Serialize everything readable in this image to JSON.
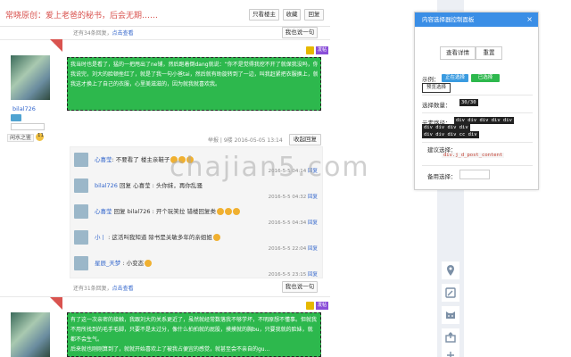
{
  "thread": {
    "title": "常晓原创：爱上老爸的秘书，后会无期……",
    "buttons": {
      "only_op": "只看楼主",
      "favorite": "收藏",
      "reply": "回复"
    }
  },
  "post_meta_top": {
    "count_text": "还有34条回复，",
    "link": "点击查看",
    "reply_btn": "我也说一句"
  },
  "post1": {
    "author": "bilal726",
    "fans_label": "闲水之鉴",
    "fans_count": "11",
    "hot_label": "热帖",
    "tag_purple": "发帖",
    "lines": [
      "我当时也是看了，猛的一把甩出了ne铺，然后跑着倒dang就说：“你不是觉得我挖不开了就保我没吗，你喜，我走着好了。”",
      "我说完，刘大的脸顿挫红了，就是了我一句小爸tai，然后就有助旋转到了一边，叫我赶紧把衣服换上，就说我要再这样，就不喜欢我了。",
      "我这才换上了自己的衣服，心里美滋滋的，因为就我就喜欢我。"
    ],
    "footer": {
      "report": "举报",
      "floor": "9楼",
      "datetime": "2016-05-05 13:14",
      "collapse": "收起回复"
    }
  },
  "replies": [
    {
      "name": "心喜莹",
      "text": ": 不要看了 楼主亲鞋子",
      "emoji_count": 3,
      "time": "2016-5-5 04:14",
      "reply": "回复"
    },
    {
      "name": "bilal726",
      "text": " 回复 心喜莹 : 头你妹，再你乱骚",
      "emoji_count": 0,
      "time": "2016-5-5 04:32",
      "reply": "回复"
    },
    {
      "name": "心喜莹",
      "text": " 回复 bilal726 : 开个玩笑拉 错楼回复类",
      "emoji_count": 3,
      "time": "2016-5-5 04:34",
      "reply": "回复"
    },
    {
      "name": "小丨",
      "text": " : 这活叫我知道 除书是关敏多年的亲姐姐",
      "emoji_count": 1,
      "time": "2016-5-5 22:04",
      "reply": "回复"
    },
    {
      "name": "星辰_天梦",
      "text": " : 小变态",
      "emoji_count": 1,
      "time": "2016-5-5 23:15",
      "reply": "回复"
    }
  ],
  "post_meta_mid": {
    "count_text": "还有31条回复，",
    "link": "点击查看",
    "reply_btn": "我也说一句"
  },
  "post2": {
    "hot_label": "热帖",
    "tag_purple": "发帖",
    "lines": [
      "有了这一次亲密的接触，我跟刘大的关系更近了，虽然就经常数落我不够学坏，不明原想不懂事。但就我不用所找到的毛手毛脚，只要不是太过分，像什么拍拍就的屁股，摸摸就的胸bu，只要我就的脸妹，就都不会生气。",
      "后来就也刚刚算到了，就就开始喜欢上了被我占便宜的感觉，就甚至会不亲自的gu..."
    ]
  },
  "panel": {
    "title": "内容选择器控制面板",
    "close_glyph": "×",
    "btn_detail": "查看详情",
    "btn_reset": "重置",
    "mode_label": "示例：",
    "pill_selecting": "正在选择",
    "pill_selected": "已选择",
    "btn_preview": "预览选择",
    "selected_count_label": "选择数量：",
    "selected_count": "30/30",
    "path_label": "元素路径：",
    "path_code_1": "div div div div div",
    "path_code_2": "div div div div",
    "path_code_3": "div div div cc div",
    "suggest_label": "建议选择：",
    "suggest_value": "div.j_d_post_content",
    "backup_label": "备用选择："
  },
  "watermark": "chajian5.com",
  "colors": {
    "green": "#2db84d",
    "panel_header": "#3a8ee6",
    "title_red": "#d9534f",
    "link_blue": "#3366cc"
  },
  "side_icons": [
    "location-icon",
    "feedback-icon",
    "cat-face-icon",
    "share-icon",
    "plus-icon"
  ]
}
